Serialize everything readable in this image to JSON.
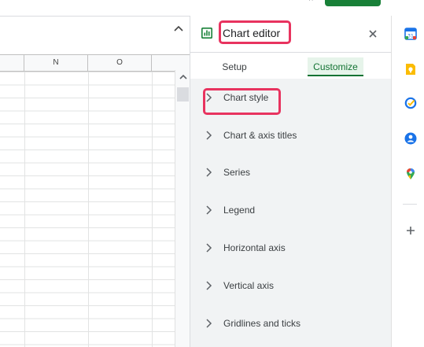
{
  "panel": {
    "title": "Chart editor",
    "tabs": [
      {
        "label": "Setup",
        "active": false
      },
      {
        "label": "Customize",
        "active": true
      }
    ],
    "sections": [
      {
        "label": "Chart style"
      },
      {
        "label": "Chart & axis titles"
      },
      {
        "label": "Series"
      },
      {
        "label": "Legend"
      },
      {
        "label": "Horizontal axis"
      },
      {
        "label": "Vertical axis"
      },
      {
        "label": "Gridlines and ticks"
      }
    ]
  },
  "grid": {
    "columns": [
      "N",
      "O"
    ]
  },
  "colors": {
    "accent": "#137333",
    "highlight": "#e8335f",
    "customize_tab_bg": "#e6f4ea"
  },
  "rail": {
    "icons": [
      "calendar-icon",
      "keep-icon",
      "tasks-icon",
      "contacts-icon",
      "maps-icon",
      "add-icon"
    ]
  }
}
